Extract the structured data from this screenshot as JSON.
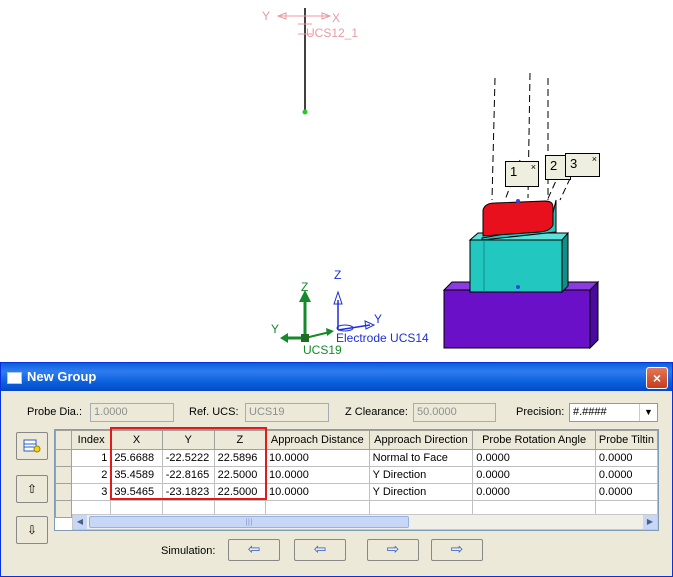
{
  "viewport": {
    "ucs_top_label": "UCS12_1",
    "ucs_top_x": "X",
    "ucs_top_y": "Y",
    "ucs19_label": "UCS19",
    "ucs19_z": "Z",
    "ucs19_y": "Y",
    "electrode_label": "Electrode UCS14",
    "electrode_z": "Z",
    "electrode_y": "Y",
    "callouts": [
      "1",
      "2",
      "3"
    ],
    "callout_close": "×",
    "colors": {
      "red_part": "#e8101c",
      "teal_part": "#22c7c0",
      "purple_base": "#6a10c8",
      "ucs19_green": "#158a2a",
      "electrode_blue": "#1c2fd8"
    }
  },
  "dialog": {
    "title": "New Group",
    "close_icon": "×",
    "probe_dia_label": "Probe Dia.:",
    "probe_dia_value": "1.0000",
    "ref_ucs_label": "Ref. UCS:",
    "ref_ucs_value": "UCS19",
    "z_clearance_label": "Z Clearance:",
    "z_clearance_value": "50.0000",
    "precision_label": "Precision:",
    "precision_value": "#.####",
    "table": {
      "headers": [
        "Index",
        "X",
        "Y",
        "Z",
        "Approach Distance",
        "Approach Direction",
        "Probe Rotation Angle",
        "Probe Tiltin"
      ],
      "rows": [
        {
          "index": "1",
          "x": "25.6688",
          "y": "-22.5222",
          "z": "22.5896",
          "approach_distance": "10.0000",
          "approach_direction": "Normal to Face",
          "probe_rotation_angle": "0.0000",
          "probe_tilting": "0.0000"
        },
        {
          "index": "2",
          "x": "35.4589",
          "y": "-22.8165",
          "z": "22.5000",
          "approach_distance": "10.0000",
          "approach_direction": "Y Direction",
          "probe_rotation_angle": "0.0000",
          "probe_tilting": "0.0000"
        },
        {
          "index": "3",
          "x": "39.5465",
          "y": "-23.1823",
          "z": "22.5000",
          "approach_distance": "10.0000",
          "approach_direction": "Y Direction",
          "probe_rotation_angle": "0.0000",
          "probe_tilting": "0.0000"
        }
      ]
    },
    "simulation_label": "Simulation:"
  }
}
